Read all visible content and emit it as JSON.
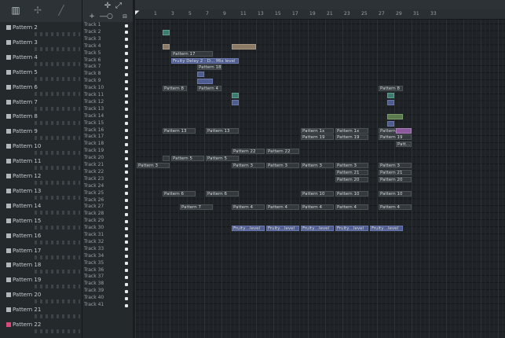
{
  "toolbar": {
    "icons": [
      "piano-icon",
      "pencil-icon",
      "line-icon"
    ]
  },
  "tracks_toolbar": {
    "icons": [
      "plus-icon",
      "slider-icon",
      "zoom-icon"
    ]
  },
  "patterns": [
    "Pattern 2",
    "Pattern 3",
    "Pattern 4",
    "Pattern 5",
    "Pattern 6",
    "Pattern 7",
    "Pattern 8",
    "Pattern 9",
    "Pattern 10",
    "Pattern 11",
    "Pattern 12",
    "Pattern 13",
    "Pattern 14",
    "Pattern 15",
    "Pattern 16",
    "Pattern 17",
    "Pattern 18",
    "Pattern 19",
    "Pattern 20",
    "Pattern 21",
    "Pattern 22"
  ],
  "tracks": [
    "Track 1",
    "Track 2",
    "Track 3",
    "Track 4",
    "Track 5",
    "Track 6",
    "Track 7",
    "Track 8",
    "Track 9",
    "Track 10",
    "Track 11",
    "Track 12",
    "Track 13",
    "Track 14",
    "Track 15",
    "Track 16",
    "Track 17",
    "Track 18",
    "Track 19",
    "Track 20",
    "Track 21",
    "Track 22",
    "Track 23",
    "Track 24",
    "Track 25",
    "Track 26",
    "Track 27",
    "Track 28",
    "Track 29",
    "Track 30",
    "Track 31",
    "Track 32",
    "Track 33",
    "Track 34",
    "Track 35",
    "Track 36",
    "Track 37",
    "Track 38",
    "Track 39",
    "Track 40",
    "Track 41"
  ],
  "ruler": [
    "1",
    "3",
    "5",
    "7",
    "9",
    "11",
    "13",
    "15",
    "17",
    "19",
    "21",
    "23",
    "25",
    "27",
    "29",
    "31",
    "33"
  ],
  "clips": [
    {
      "track": 2,
      "bar": 4,
      "len": 1,
      "label": "",
      "style": "teal"
    },
    {
      "track": 4,
      "bar": 4,
      "len": 1,
      "label": "",
      "style": "tan"
    },
    {
      "track": 4,
      "bar": 12,
      "len": 3,
      "label": "",
      "style": "tan"
    },
    {
      "track": 5,
      "bar": 5,
      "len": 5,
      "label": "Pattern 17",
      "style": "pat-clip"
    },
    {
      "track": 6,
      "bar": 5,
      "len": 8,
      "label": "Fruity Delay 2 - D…  Mix level",
      "style": "auto"
    },
    {
      "track": 7,
      "bar": 8,
      "len": 3,
      "label": "Pattern 18",
      "style": "pat-clip"
    },
    {
      "track": 8,
      "bar": 8,
      "len": 1,
      "label": "",
      "style": "auto"
    },
    {
      "track": 9,
      "bar": 8,
      "len": 2,
      "label": "",
      "style": "auto"
    },
    {
      "track": 10,
      "bar": 4,
      "len": 3,
      "label": "Pattern 8",
      "style": "pat-clip"
    },
    {
      "track": 10,
      "bar": 8,
      "len": 3,
      "label": "Pattern 4",
      "style": "pat-clip"
    },
    {
      "track": 10,
      "bar": 29,
      "len": 3,
      "label": "Pattern 8",
      "style": "pat-clip"
    },
    {
      "track": 11,
      "bar": 12,
      "len": 1,
      "label": "",
      "style": "teal"
    },
    {
      "track": 11,
      "bar": 30,
      "len": 1,
      "label": "",
      "style": "teal"
    },
    {
      "track": 12,
      "bar": 12,
      "len": 1,
      "label": "",
      "style": "auto"
    },
    {
      "track": 12,
      "bar": 30,
      "len": 1,
      "label": "",
      "style": "auto"
    },
    {
      "track": 14,
      "bar": 30,
      "len": 2,
      "label": "",
      "style": "green"
    },
    {
      "track": 15,
      "bar": 30,
      "len": 1,
      "label": "",
      "style": "auto"
    },
    {
      "track": 16,
      "bar": 4,
      "len": 4,
      "label": "Pattern 13",
      "style": "pat-clip"
    },
    {
      "track": 16,
      "bar": 9,
      "len": 4,
      "label": "Pattern 13",
      "style": "pat-clip"
    },
    {
      "track": 16,
      "bar": 20,
      "len": 4,
      "label": "Pattern 1x",
      "style": "pat-clip"
    },
    {
      "track": 16,
      "bar": 24,
      "len": 4,
      "label": "Pattern 1x",
      "style": "pat-clip"
    },
    {
      "track": 16,
      "bar": 29,
      "len": 4,
      "label": "Pattern 1x",
      "style": "pat-clip"
    },
    {
      "track": 16,
      "bar": 31,
      "len": 2,
      "label": "",
      "style": "purple"
    },
    {
      "track": 17,
      "bar": 20,
      "len": 4,
      "label": "Pattern 19",
      "style": "pat-clip"
    },
    {
      "track": 17,
      "bar": 24,
      "len": 4,
      "label": "Pattern 19",
      "style": "pat-clip"
    },
    {
      "track": 17,
      "bar": 29,
      "len": 4,
      "label": "Pattern 19",
      "style": "pat-clip"
    },
    {
      "track": 18,
      "bar": 31,
      "len": 2,
      "label": "Patt…11",
      "style": "pat-clip"
    },
    {
      "track": 19,
      "bar": 12,
      "len": 4,
      "label": "Pattern 22",
      "style": "pat-clip"
    },
    {
      "track": 19,
      "bar": 16,
      "len": 4,
      "label": "Pattern 22",
      "style": "pat-clip"
    },
    {
      "track": 20,
      "bar": 4,
      "len": 1,
      "label": "",
      "style": "pat-clip"
    },
    {
      "track": 20,
      "bar": 5,
      "len": 4,
      "label": "Pattern 5",
      "style": "pat-clip"
    },
    {
      "track": 20,
      "bar": 9,
      "len": 4,
      "label": "Pattern 5",
      "style": "pat-clip"
    },
    {
      "track": 21,
      "bar": 1,
      "len": 4,
      "label": "Pattern 3",
      "style": "pat-clip"
    },
    {
      "track": 21,
      "bar": 12,
      "len": 4,
      "label": "Pattern 3",
      "style": "pat-clip"
    },
    {
      "track": 21,
      "bar": 16,
      "len": 4,
      "label": "Pattern 3",
      "style": "pat-clip"
    },
    {
      "track": 21,
      "bar": 20,
      "len": 4,
      "label": "Pattern 3",
      "style": "pat-clip"
    },
    {
      "track": 21,
      "bar": 24,
      "len": 4,
      "label": "Pattern 3",
      "style": "pat-clip"
    },
    {
      "track": 21,
      "bar": 29,
      "len": 4,
      "label": "Pattern 3",
      "style": "pat-clip"
    },
    {
      "track": 22,
      "bar": 24,
      "len": 4,
      "label": "Pattern 21",
      "style": "pat-clip"
    },
    {
      "track": 22,
      "bar": 29,
      "len": 4,
      "label": "Pattern 21",
      "style": "pat-clip"
    },
    {
      "track": 23,
      "bar": 24,
      "len": 4,
      "label": "Pattern 20",
      "style": "pat-clip"
    },
    {
      "track": 23,
      "bar": 29,
      "len": 4,
      "label": "Pattern 20",
      "style": "pat-clip"
    },
    {
      "track": 25,
      "bar": 4,
      "len": 4,
      "label": "Pattern 6",
      "style": "pat-clip"
    },
    {
      "track": 25,
      "bar": 9,
      "len": 4,
      "label": "Pattern 6",
      "style": "pat-clip"
    },
    {
      "track": 25,
      "bar": 20,
      "len": 4,
      "label": "Pattern 10",
      "style": "pat-clip"
    },
    {
      "track": 25,
      "bar": 24,
      "len": 4,
      "label": "Pattern 10",
      "style": "pat-clip"
    },
    {
      "track": 25,
      "bar": 29,
      "len": 4,
      "label": "Pattern 10",
      "style": "pat-clip"
    },
    {
      "track": 27,
      "bar": 6,
      "len": 4,
      "label": "Pattern 7",
      "style": "pat-clip"
    },
    {
      "track": 27,
      "bar": 12,
      "len": 4,
      "label": "Pattern 4",
      "style": "pat-clip"
    },
    {
      "track": 27,
      "bar": 16,
      "len": 4,
      "label": "Pattern 4",
      "style": "pat-clip"
    },
    {
      "track": 27,
      "bar": 20,
      "len": 4,
      "label": "Pattern 4",
      "style": "pat-clip"
    },
    {
      "track": 27,
      "bar": 24,
      "len": 4,
      "label": "Pattern 4",
      "style": "pat-clip"
    },
    {
      "track": 27,
      "bar": 29,
      "len": 4,
      "label": "Pattern 4",
      "style": "pat-clip"
    },
    {
      "track": 30,
      "bar": 12,
      "len": 4,
      "label": "Fruity…level",
      "style": "auto"
    },
    {
      "track": 30,
      "bar": 16,
      "len": 4,
      "label": "Fruity…level",
      "style": "auto"
    },
    {
      "track": 30,
      "bar": 20,
      "len": 4,
      "label": "Fruity…level",
      "style": "auto"
    },
    {
      "track": 30,
      "bar": 24,
      "len": 4,
      "label": "Fruity…level",
      "style": "auto"
    },
    {
      "track": 30,
      "bar": 28,
      "len": 4,
      "label": "Fruity…level",
      "style": "auto"
    }
  ]
}
